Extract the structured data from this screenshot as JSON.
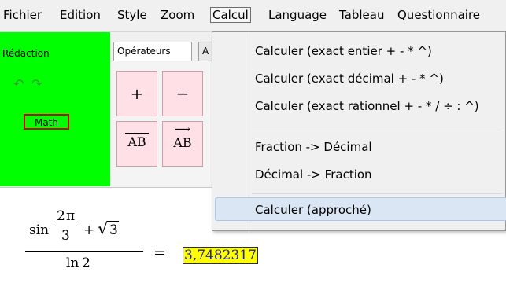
{
  "menubar": {
    "items": [
      "Fichier",
      "Edition",
      "Style",
      "Zoom",
      "Calcul",
      "Language",
      "Tableau",
      "Questionnaire"
    ],
    "active": "Calcul"
  },
  "left_panel": {
    "title": "Rédaction",
    "math_button": "Math",
    "undo_icon": "undo-arrow-icon",
    "redo_icon": "redo-arrow-icon"
  },
  "tabs": {
    "items": [
      "Opérateurs",
      "A"
    ]
  },
  "operators": {
    "plus": "+",
    "minus": "−",
    "segment": "AB",
    "vector": "AB"
  },
  "calcul_menu": {
    "items": [
      "Calculer (exact entier + - * ^)",
      "Calculer (exact décimal + - * ^)",
      "Calculer (exact rationnel + - * / ÷ : ^)",
      "Fraction -> Décimal",
      "Décimal -> Fraction",
      "Calculer (approché)"
    ],
    "highlighted": "Calculer (approché)"
  },
  "formula": {
    "sin": "sin",
    "num2": "2",
    "pi": "π",
    "den3": "3",
    "plus": "+",
    "sqrt3": "3",
    "ln": "ln",
    "lnarg": "2",
    "equals": "=",
    "result": "3,7482317"
  },
  "colors": {
    "green_panel": "#00ff00",
    "operator_button": "#ffe0e6",
    "result_highlight": "#ffff00",
    "math_border": "#d40000"
  }
}
